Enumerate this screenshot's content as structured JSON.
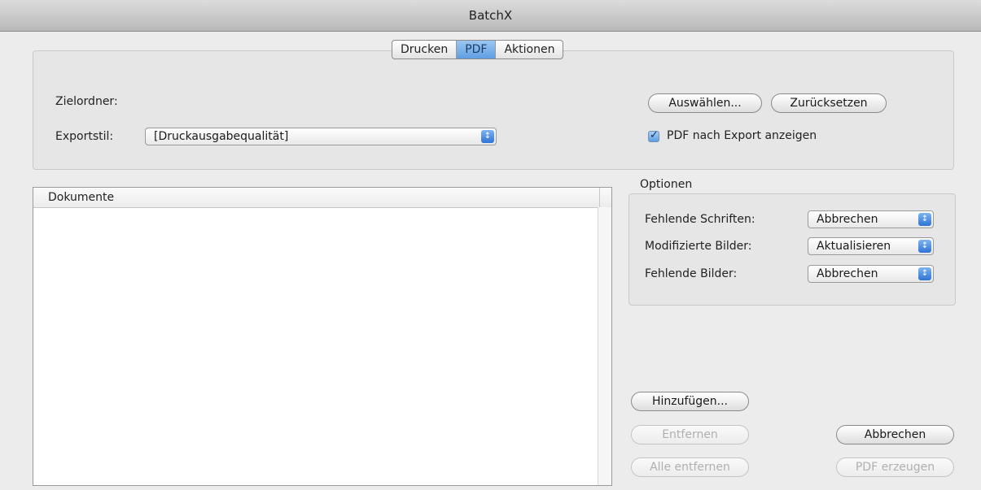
{
  "window": {
    "title": "BatchX"
  },
  "tabs": [
    {
      "label": "Drucken",
      "active": false
    },
    {
      "label": "PDF",
      "active": true
    },
    {
      "label": "Aktionen",
      "active": false
    }
  ],
  "pdf": {
    "target_folder_label": "Zielordner:",
    "export_style_label": "Exportstil:",
    "export_style_value": "[Druckausgabequalität]",
    "choose_button": "Auswählen...",
    "reset_button": "Zurücksetzen",
    "show_pdf_checkbox": {
      "label": "PDF nach Export anzeigen",
      "checked": true
    }
  },
  "documents": {
    "column_header": "Dokumente",
    "items": []
  },
  "options": {
    "title": "Optionen",
    "rows": [
      {
        "label": "Fehlende Schriften:",
        "value": "Abbrechen"
      },
      {
        "label": "Modifizierte Bilder:",
        "value": "Aktualisieren"
      },
      {
        "label": "Fehlende Bilder:",
        "value": "Abbrechen"
      }
    ]
  },
  "actions": {
    "add": "Hinzufügen...",
    "remove": "Entfernen",
    "remove_all": "Alle entfernen",
    "cancel": "Abbrechen",
    "create_pdf": "PDF erzeugen"
  },
  "colors": {
    "accent": "#5f9ee3",
    "window_bg": "#ececec"
  }
}
